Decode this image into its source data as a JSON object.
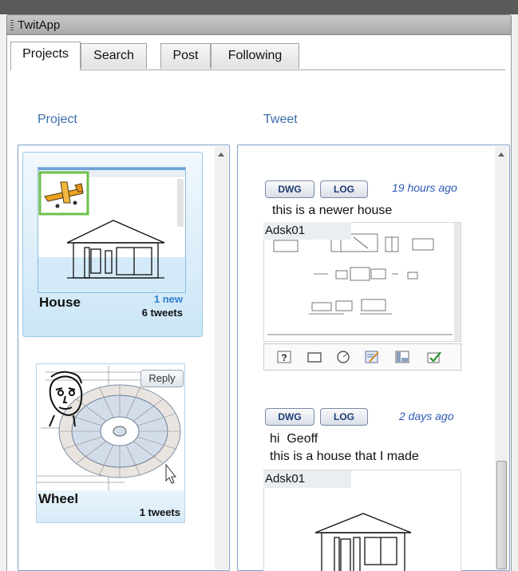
{
  "window": {
    "title": "TwitApp"
  },
  "tabs": [
    {
      "label": "Projects",
      "active": true
    },
    {
      "label": "Search",
      "active": false
    },
    {
      "label": "Post",
      "active": false
    },
    {
      "label": "Following",
      "active": false
    }
  ],
  "columns": {
    "project_header": "Project",
    "tweet_header": "Tweet"
  },
  "projects": [
    {
      "name": "House",
      "new_label": "1 new",
      "tweets_label": "6 tweets",
      "selected": true
    },
    {
      "name": "Wheel",
      "tweets_label": "1 tweets",
      "reply_label": "Reply",
      "selected": false
    }
  ],
  "tweets": [
    {
      "dwg_label": "DWG",
      "log_label": "LOG",
      "time": "19 hours ago",
      "message_lines": [
        "this is a newer house"
      ],
      "user": "Adsk01",
      "action_icons": [
        "help-icon",
        "rectangle-icon",
        "compass-icon",
        "note-icon",
        "layout-icon",
        "checklist-icon"
      ]
    },
    {
      "dwg_label": "DWG",
      "log_label": "LOG",
      "time": "2 days ago",
      "message_lines": [
        "hi  Geoff",
        "this is a house that I made"
      ],
      "user": "Adsk01"
    }
  ],
  "colors": {
    "accent": "#3b6ea8",
    "selection": "#cbe6f7",
    "new_badge": "#2e80d3"
  }
}
